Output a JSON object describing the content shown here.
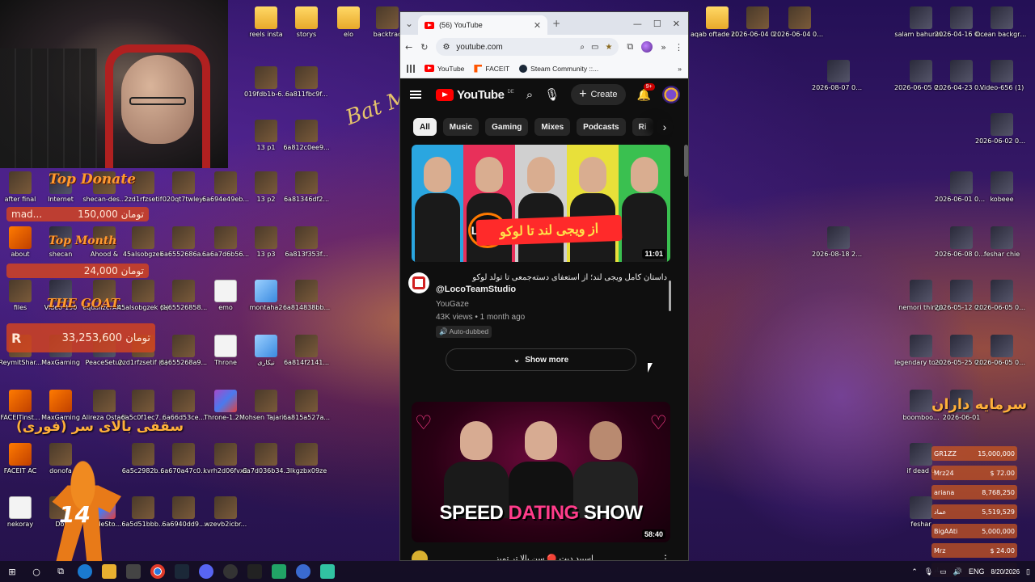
{
  "desktop": {
    "icons": [
      {
        "label": "reels insta",
        "kind": "folder"
      },
      {
        "label": "storys",
        "kind": "folder"
      },
      {
        "label": "elo",
        "kind": "folder"
      },
      {
        "label": "backtrac",
        "kind": "img"
      },
      {
        "label": "aqab oftade clips",
        "kind": "folder"
      },
      {
        "label": "2026-06-04 04-37-29",
        "kind": "img"
      },
      {
        "label": "2026-06-04 04-37-35",
        "kind": "img"
      },
      {
        "label": "salam bahunw...",
        "kind": "dark"
      },
      {
        "label": "2026-04-16 03-44-24",
        "kind": "dark"
      },
      {
        "label": "Ocean backgroun...",
        "kind": "dark"
      },
      {
        "label": "2026-08-07 01-35-47",
        "kind": "dark"
      },
      {
        "label": "2026-06-05 00-23-28",
        "kind": "dark"
      },
      {
        "label": "2026-04-23 02-55-04",
        "kind": "dark"
      },
      {
        "label": "Video-656 (1)",
        "kind": "dark"
      },
      {
        "label": "2026-06-02 00-35-51",
        "kind": "dark"
      },
      {
        "label": "019fdb1b-6...",
        "kind": "img"
      },
      {
        "label": "6a811fbc9f...",
        "kind": "img"
      },
      {
        "label": "13 p1",
        "kind": "img"
      },
      {
        "label": "6a812c0ee9...",
        "kind": "img"
      },
      {
        "label": "after final",
        "kind": "img"
      },
      {
        "label": "Internet",
        "kind": "dark"
      },
      {
        "label": "shecan-des...",
        "kind": "img"
      },
      {
        "label": "2zd1rfzsetif",
        "kind": "img"
      },
      {
        "label": "020qt7twleyi",
        "kind": "img"
      },
      {
        "label": "6a694e49eb...",
        "kind": "img"
      },
      {
        "label": "13 p2",
        "kind": "img"
      },
      {
        "label": "6a81346df2...",
        "kind": "img"
      },
      {
        "label": "2026-06-01 02-27-22",
        "kind": "dark"
      },
      {
        "label": "kobeee",
        "kind": "dark"
      },
      {
        "label": "about",
        "kind": "app"
      },
      {
        "label": "shecan",
        "kind": "dark"
      },
      {
        "label": "Ahood &",
        "kind": "img"
      },
      {
        "label": "45alsobgzek",
        "kind": "img"
      },
      {
        "label": "6a6552686a...",
        "kind": "img"
      },
      {
        "label": "6a6a7d6b56...",
        "kind": "img"
      },
      {
        "label": "13 p3",
        "kind": "img"
      },
      {
        "label": "6a813f353f...",
        "kind": "img"
      },
      {
        "label": "2026-08-18 21-30-22",
        "kind": "dark"
      },
      {
        "label": "2026-06-08 02-31-38",
        "kind": "dark"
      },
      {
        "label": "feshar chie",
        "kind": "dark"
      },
      {
        "label": "files",
        "kind": "img"
      },
      {
        "label": "Video-190",
        "kind": "dark"
      },
      {
        "label": "equalizerAP...",
        "kind": "img"
      },
      {
        "label": "45alsobgzek (1)",
        "kind": "img"
      },
      {
        "label": "6a65526858...",
        "kind": "img"
      },
      {
        "label": "emo",
        "kind": "doc"
      },
      {
        "label": "montaha2",
        "kind": "blue"
      },
      {
        "label": "6a814838bb...",
        "kind": "img"
      },
      {
        "label": "nemori things",
        "kind": "dark"
      },
      {
        "label": "2026-05-12 03-43-46",
        "kind": "dark"
      },
      {
        "label": "2026-06-05 00-36-05",
        "kind": "dark"
      },
      {
        "label": "ReymitShar...",
        "kind": "img"
      },
      {
        "label": "MaxGaming",
        "kind": "dark"
      },
      {
        "label": "PeaceSetup",
        "kind": "dark"
      },
      {
        "label": "2zd1rfzsetif (1)",
        "kind": "img"
      },
      {
        "label": "6a655268a9...",
        "kind": "img"
      },
      {
        "label": "Throne",
        "kind": "doc"
      },
      {
        "label": "نیکاری",
        "kind": "blue"
      },
      {
        "label": "6a814f2141...",
        "kind": "img"
      },
      {
        "label": "legendary to silver",
        "kind": "dark"
      },
      {
        "label": "2026-05-25 03-16-59",
        "kind": "dark"
      },
      {
        "label": "2026-06-05 02-22-46",
        "kind": "dark"
      },
      {
        "label": "FACEITinst...",
        "kind": "app"
      },
      {
        "label": "MaxGaming",
        "kind": "app"
      },
      {
        "label": "Alireza Ostadi",
        "kind": "img"
      },
      {
        "label": "6a5c0f1ec7...",
        "kind": "img"
      },
      {
        "label": "6a66d53ce...",
        "kind": "img"
      },
      {
        "label": "Throne-1.2....",
        "kind": "rar"
      },
      {
        "label": "Mohsen Tajari - Ber...",
        "kind": "img"
      },
      {
        "label": "6a815a527a...",
        "kind": "img"
      },
      {
        "label": "boomboo...",
        "kind": "dark"
      },
      {
        "label": "2026-06-01",
        "kind": "dark"
      },
      {
        "label": "FACEIT AC",
        "kind": "app"
      },
      {
        "label": "donofa",
        "kind": "img"
      },
      {
        "label": "6a5c2982b...",
        "kind": "img"
      },
      {
        "label": "6a670a47c0...",
        "kind": "img"
      },
      {
        "label": "kvrh2d06fvx1",
        "kind": "img"
      },
      {
        "label": "6a7d036b34...",
        "kind": "img"
      },
      {
        "label": "3lkgzbx09ze",
        "kind": "img"
      },
      {
        "label": "if dead u",
        "kind": "dark"
      },
      {
        "label": "nekoray",
        "kind": "doc"
      },
      {
        "label": "Dol",
        "kind": "img"
      },
      {
        "label": "rottleSto...",
        "kind": "rar"
      },
      {
        "label": "6a5d51bbb...",
        "kind": "img"
      },
      {
        "label": "6a6940dd9...",
        "kind": "img"
      },
      {
        "label": "wzevb2icbr...",
        "kind": "img"
      },
      {
        "label": "feshar",
        "kind": "dark"
      }
    ]
  },
  "overlays": {
    "top_donate_title": "Top Donate",
    "top_donate_amount": "150,000 تومان",
    "top_donate_name": "mad...",
    "top_month_title": "Top Month",
    "top_month_amount": "24,000 تومان",
    "goat_title": "THE GOAT",
    "goat_amount": "33,253,600 تومان",
    "goat_initial": "R",
    "ceiling_text": "سقفی بالای سر (فوری)",
    "capital_text": "سرمایه داران",
    "cs_number": "14",
    "donors": [
      {
        "name": "GR1ZZ",
        "amount": "15,000,000"
      },
      {
        "name": "Mrz24",
        "amount": "$ 72.00"
      },
      {
        "name": "ariana",
        "amount": "8,768,250"
      },
      {
        "name": "عماد",
        "amount": "5,519,529"
      },
      {
        "name": "BigAAti",
        "amount": "5,000,000"
      },
      {
        "name": "Mrz",
        "amount": "$ 24.00"
      },
      {
        "name": "عماد",
        "amount": "$ 24.00"
      }
    ]
  },
  "browser": {
    "tab_title": "(56) YouTube",
    "url": "youtube.com",
    "bookmarks": [
      {
        "label": "YouTube",
        "icon": "youtube-icon"
      },
      {
        "label": "FACEIT",
        "icon": "faceit-icon"
      },
      {
        "label": "Steam Community ::...",
        "icon": "steam-icon"
      }
    ]
  },
  "youtube": {
    "logo_text": "YouTube",
    "region": "DE",
    "create_label": "Create",
    "notif_count": "9+",
    "chips": [
      "All",
      "Music",
      "Gaming",
      "Mixes",
      "Podcasts",
      "Ri"
    ],
    "video1": {
      "banner_text": "از ویجی لند تا لوکو",
      "loco_text": "LOCO",
      "duration": "11:01",
      "title": "داستان کامل ویجی لند؛ از استعفای دسته‌جمعی تا تولد لوکو",
      "title_handle": "@LocoTeamStudio",
      "channel": "YouGaze",
      "stats": "43K views • 1 month ago",
      "badge": "Auto-dubbed"
    },
    "show_more": "Show more",
    "video2": {
      "speed_text_1": "SPEED ",
      "speed_text_2": "DATING",
      "speed_text_3": " SHOW",
      "duration": "58:40",
      "title": "اسپید دیت 🔴 سن بالا تر تمیز"
    }
  },
  "taskbar": {
    "language": "ENG",
    "date": "8/20/2026"
  }
}
